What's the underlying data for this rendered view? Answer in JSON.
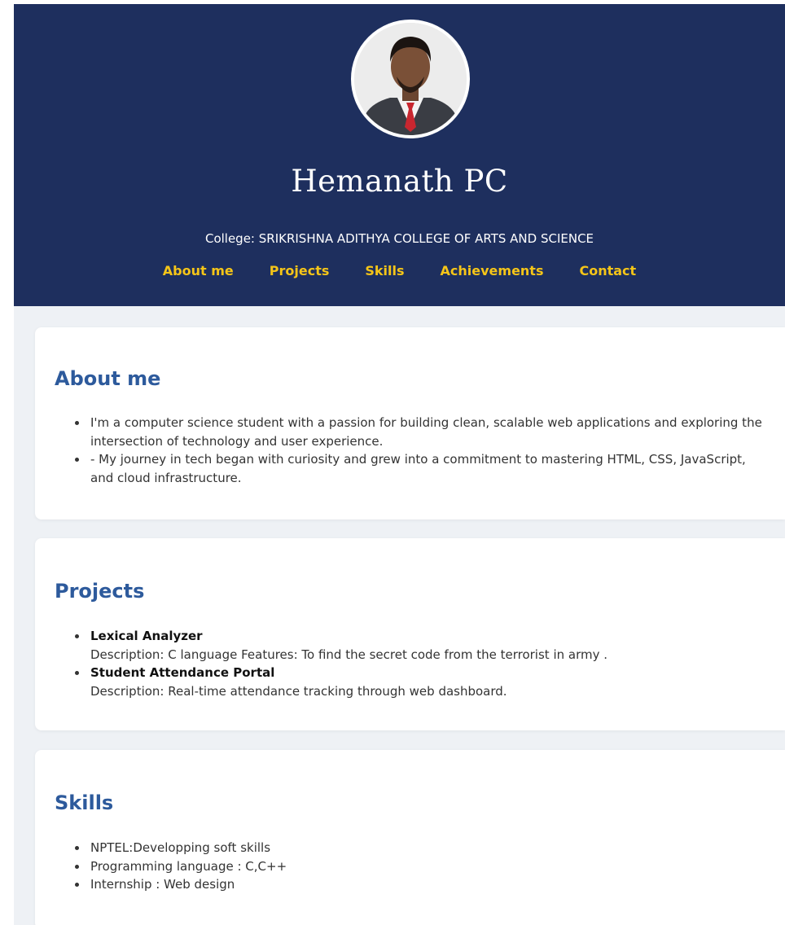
{
  "header": {
    "name": "Hemanath PC",
    "college": "College: SRIKRISHNA ADITHYA COLLEGE OF ARTS AND SCIENCE",
    "bg_color": "#1e2f5e",
    "nav_color": "#f5c518"
  },
  "nav": {
    "items": [
      {
        "label": "About me"
      },
      {
        "label": "Projects"
      },
      {
        "label": "Skills"
      },
      {
        "label": "Achievements"
      },
      {
        "label": "Contact"
      }
    ]
  },
  "about": {
    "heading": "About me",
    "items": [
      "I'm a computer science student with a passion for building clean, scalable web applications and exploring the intersection of technology and user experience.",
      "- My journey in tech began with curiosity and grew into a commitment to mastering HTML, CSS, JavaScript, and cloud infrastructure."
    ]
  },
  "projects": {
    "heading": "Projects",
    "items": [
      {
        "title": "Lexical Analyzer",
        "description": "Description: C language Features: To find the secret code from the terrorist in army ."
      },
      {
        "title": "Student Attendance Portal",
        "description": "Description: Real-time attendance tracking through web dashboard."
      }
    ]
  },
  "skills": {
    "heading": "Skills",
    "items": [
      "NPTEL:Developping soft skills",
      "Programming language : C,C++",
      "Internship : Web design"
    ]
  },
  "accent_color": "#2d5a9c"
}
